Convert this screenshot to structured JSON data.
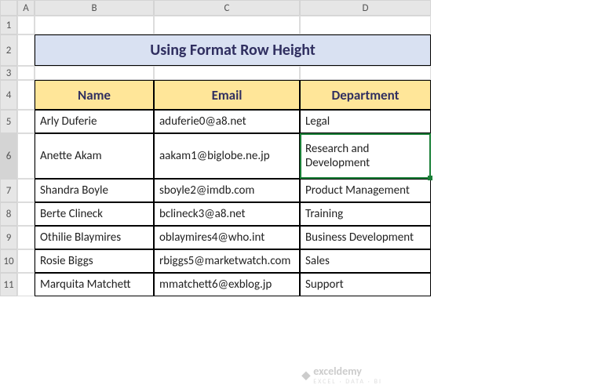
{
  "columns": [
    "",
    "A",
    "B",
    "C",
    "D"
  ],
  "row_labels": [
    "1",
    "2",
    "3",
    "4",
    "5",
    "6",
    "7",
    "8",
    "9",
    "10",
    "11"
  ],
  "title": "Using Format Row Height",
  "headers": {
    "name": "Name",
    "email": "Email",
    "dept": "Department"
  },
  "rows": [
    {
      "name": "Arly Duferie",
      "email": "aduferie0@a8.net",
      "dept": "Legal"
    },
    {
      "name": "Anette Akam",
      "email": "aakam1@biglobe.ne.jp",
      "dept": "Research and Development"
    },
    {
      "name": "Shandra Boyle",
      "email": "sboyle2@imdb.com",
      "dept": "Product Management"
    },
    {
      "name": "Berte Clineck",
      "email": "bclineck3@a8.net",
      "dept": "Training"
    },
    {
      "name": "Othilie Blaymires",
      "email": "oblaymires4@who.int",
      "dept": "Business Development"
    },
    {
      "name": "Rosie Biggs",
      "email": "rbiggs5@marketwatch.com",
      "dept": "Sales"
    },
    {
      "name": "Marquita Matchett",
      "email": "mmatchett6@exblog.jp",
      "dept": "Support"
    }
  ],
  "watermark": {
    "brand": "exceldemy",
    "tag": "EXCEL · DATA · BI"
  },
  "active_cell": "D6"
}
